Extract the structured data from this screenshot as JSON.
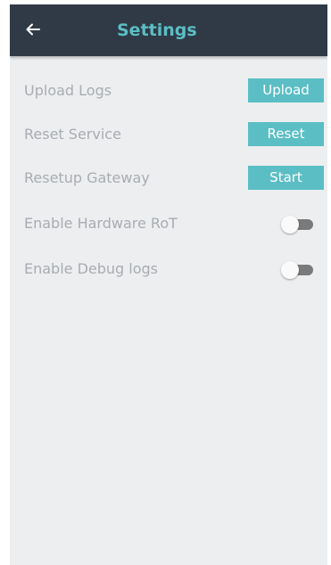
{
  "header": {
    "title": "Settings",
    "back_icon": "arrow-left-icon",
    "background_color": "#2f3a46",
    "title_color": "#5bbec4"
  },
  "settings": {
    "upload_logs": {
      "label": "Upload Logs",
      "button_label": "Upload"
    },
    "reset_service": {
      "label": "Reset Service",
      "button_label": "Reset"
    },
    "resetup_gateway": {
      "label": "Resetup Gateway",
      "button_label": "Start"
    },
    "enable_hardware_rot": {
      "label": "Enable Hardware RoT",
      "enabled": false
    },
    "enable_debug_logs": {
      "label": "Enable Debug logs",
      "enabled": false
    }
  },
  "colors": {
    "accent": "#5bbec4",
    "page_background": "#eceef0",
    "label_text": "#a9acb1",
    "toggle_track_off": "#7a7a7a"
  }
}
